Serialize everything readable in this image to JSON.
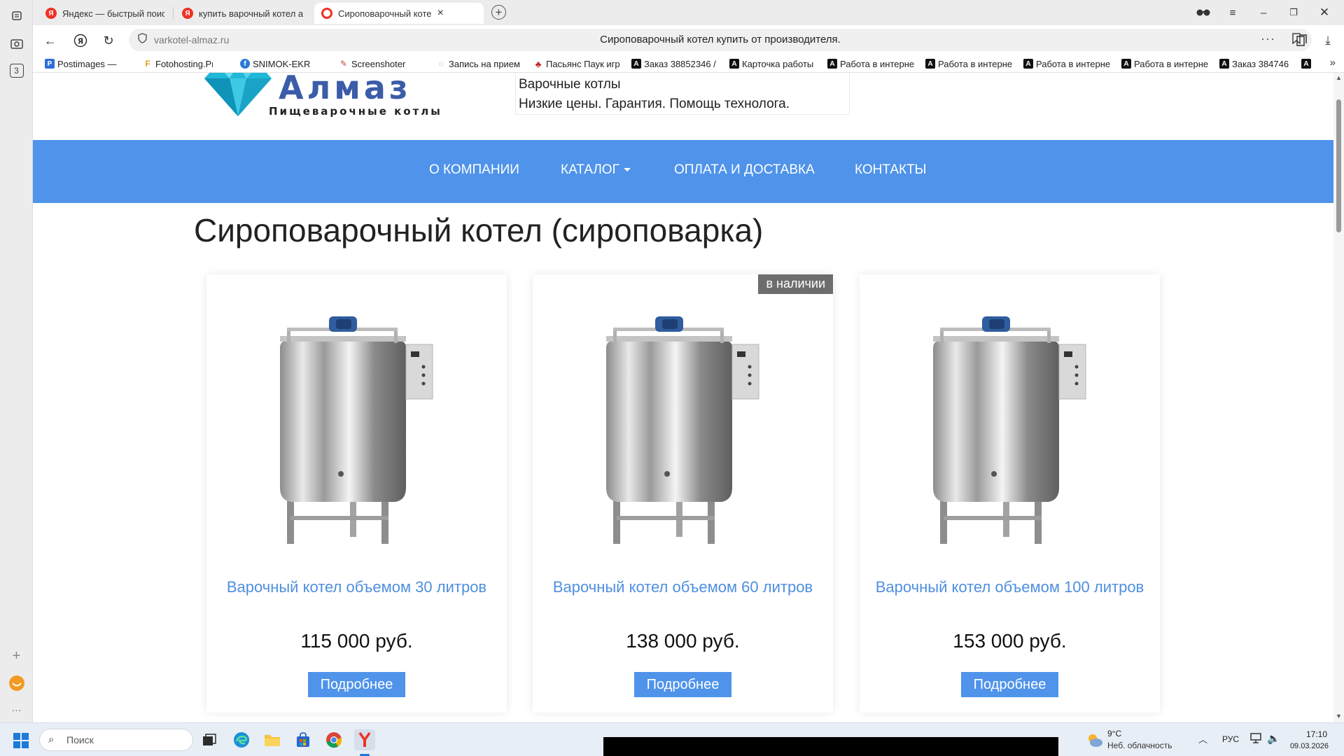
{
  "browser": {
    "tabs": [
      {
        "title": "Яндекс — быстрый поиск",
        "favicon": "yandex-icon",
        "color": "#ef3124"
      },
      {
        "title": "купить варочный котел а",
        "favicon": "yandex-icon",
        "color": "#ef3124"
      },
      {
        "title": "Сироповарочный коте",
        "favicon": "opera-icon",
        "color": "#ef3124",
        "active": true
      }
    ],
    "new_tab_label": "+",
    "address": {
      "domain": "varkotel-almaz.ru",
      "page_title": "Сироповарочный котел купить от производителя.",
      "dots": "···"
    },
    "bookmarks": [
      {
        "label": "Postimages — бес",
        "icon": "P",
        "color": "#2d6fd6"
      },
      {
        "label": "Fotohosting.Pro -",
        "icon": "F",
        "color": "#e3a21a"
      },
      {
        "label": "SNIMOK-EKRANA",
        "icon": "f",
        "color": "#2a7bd8"
      },
      {
        "label": "Screenshoter | An",
        "icon": "✎",
        "color": "#d04545"
      },
      {
        "label": "Запись на прием",
        "icon": "◌",
        "color": "#6a9bd0"
      },
      {
        "label": "Пасьянс Паук игр",
        "icon": "♣",
        "color": "#c22525"
      },
      {
        "label": "Заказ 38852346 /",
        "icon": "A",
        "color": "#111111"
      },
      {
        "label": "Карточка работы",
        "icon": "A",
        "color": "#111111"
      },
      {
        "label": "Работа в интерне",
        "icon": "A",
        "color": "#111111"
      },
      {
        "label": "Работа в интерне",
        "icon": "A",
        "color": "#111111"
      },
      {
        "label": "Работа в интерне",
        "icon": "A",
        "color": "#111111"
      },
      {
        "label": "Работа в интерне",
        "icon": "A",
        "color": "#111111"
      },
      {
        "label": "Заказ 384746",
        "icon": "A",
        "color": "#111111"
      },
      {
        "label": "",
        "icon": "A",
        "color": "#111111"
      }
    ],
    "bookmarks_more": "»",
    "sidebar_badge": "3"
  },
  "site": {
    "logo_word": "Алмаз",
    "logo_sub": "Пищеварочные котлы",
    "tagline_1": "Варочные котлы",
    "tagline_2": "Низкие цены. Гарантия. Помощь технолога.",
    "nav": [
      {
        "label": "О КОМПАНИИ"
      },
      {
        "label": "КАТАЛОГ"
      },
      {
        "label": "ОПЛАТА И ДОСТАВКА"
      },
      {
        "label": "КОНТАКТЫ"
      }
    ],
    "nav_color": "#4f93ea",
    "heading": "Сироповарочный котел (сироповарка)",
    "products": [
      {
        "name": "Варочный котел объемом 30 литров",
        "price": "115 000 руб.",
        "button": "Подробнее",
        "badge": ""
      },
      {
        "name": "Варочный котел объемом 60 литров",
        "price": "138 000 руб.",
        "button": "Подробнее",
        "badge": "в наличии"
      },
      {
        "name": "Варочный котел объемом 100 литров",
        "price": "153 000 руб.",
        "button": "Подробнее",
        "badge": ""
      }
    ]
  },
  "taskbar": {
    "search_placeholder": "Поиск",
    "weather_temp": "9°C",
    "weather_desc": "Неб. облачность",
    "lang": "РУС",
    "time": "17:10",
    "date": "09.03.2026"
  }
}
